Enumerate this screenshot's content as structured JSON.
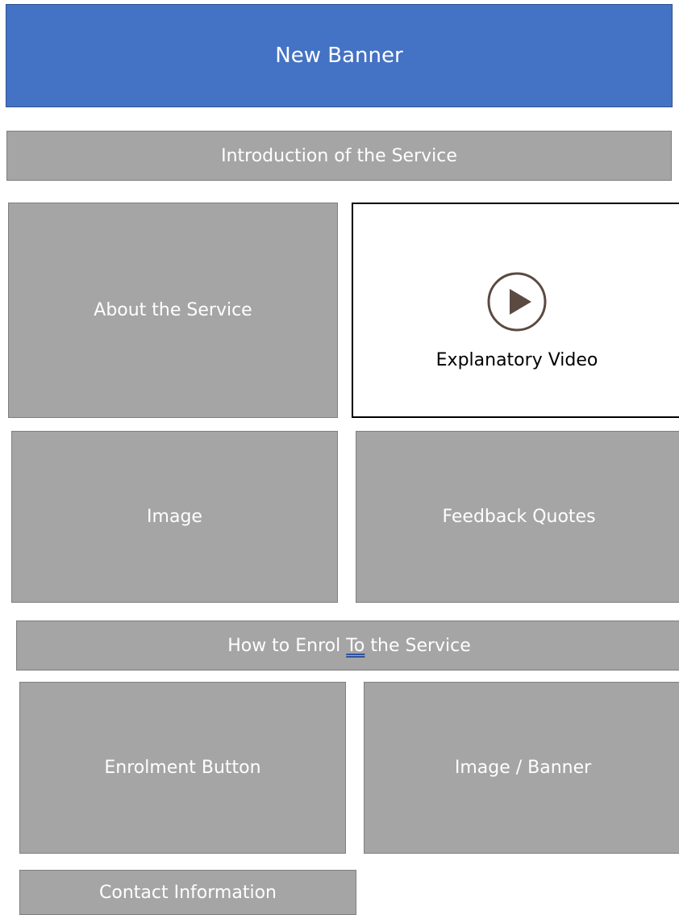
{
  "banner": {
    "label": "New Banner",
    "color": "#4472c4"
  },
  "intro": {
    "label": "Introduction of the Service"
  },
  "about": {
    "label": "About the Service"
  },
  "video": {
    "label": "Explanatory Video",
    "icon": "play-icon"
  },
  "image": {
    "label": "Image"
  },
  "feedback": {
    "label": "Feedback Quotes"
  },
  "enrol_heading": {
    "before": "How to Enrol ",
    "underlined": "To",
    "after": " the Service"
  },
  "enrol_button": {
    "label": "Enrolment Button"
  },
  "image_banner": {
    "label": "Image / Banner"
  },
  "contact": {
    "label": "Contact Information"
  },
  "colors": {
    "block_fill": "#a5a5a5",
    "block_border": "#7f7f7f",
    "text": "#ffffff"
  }
}
